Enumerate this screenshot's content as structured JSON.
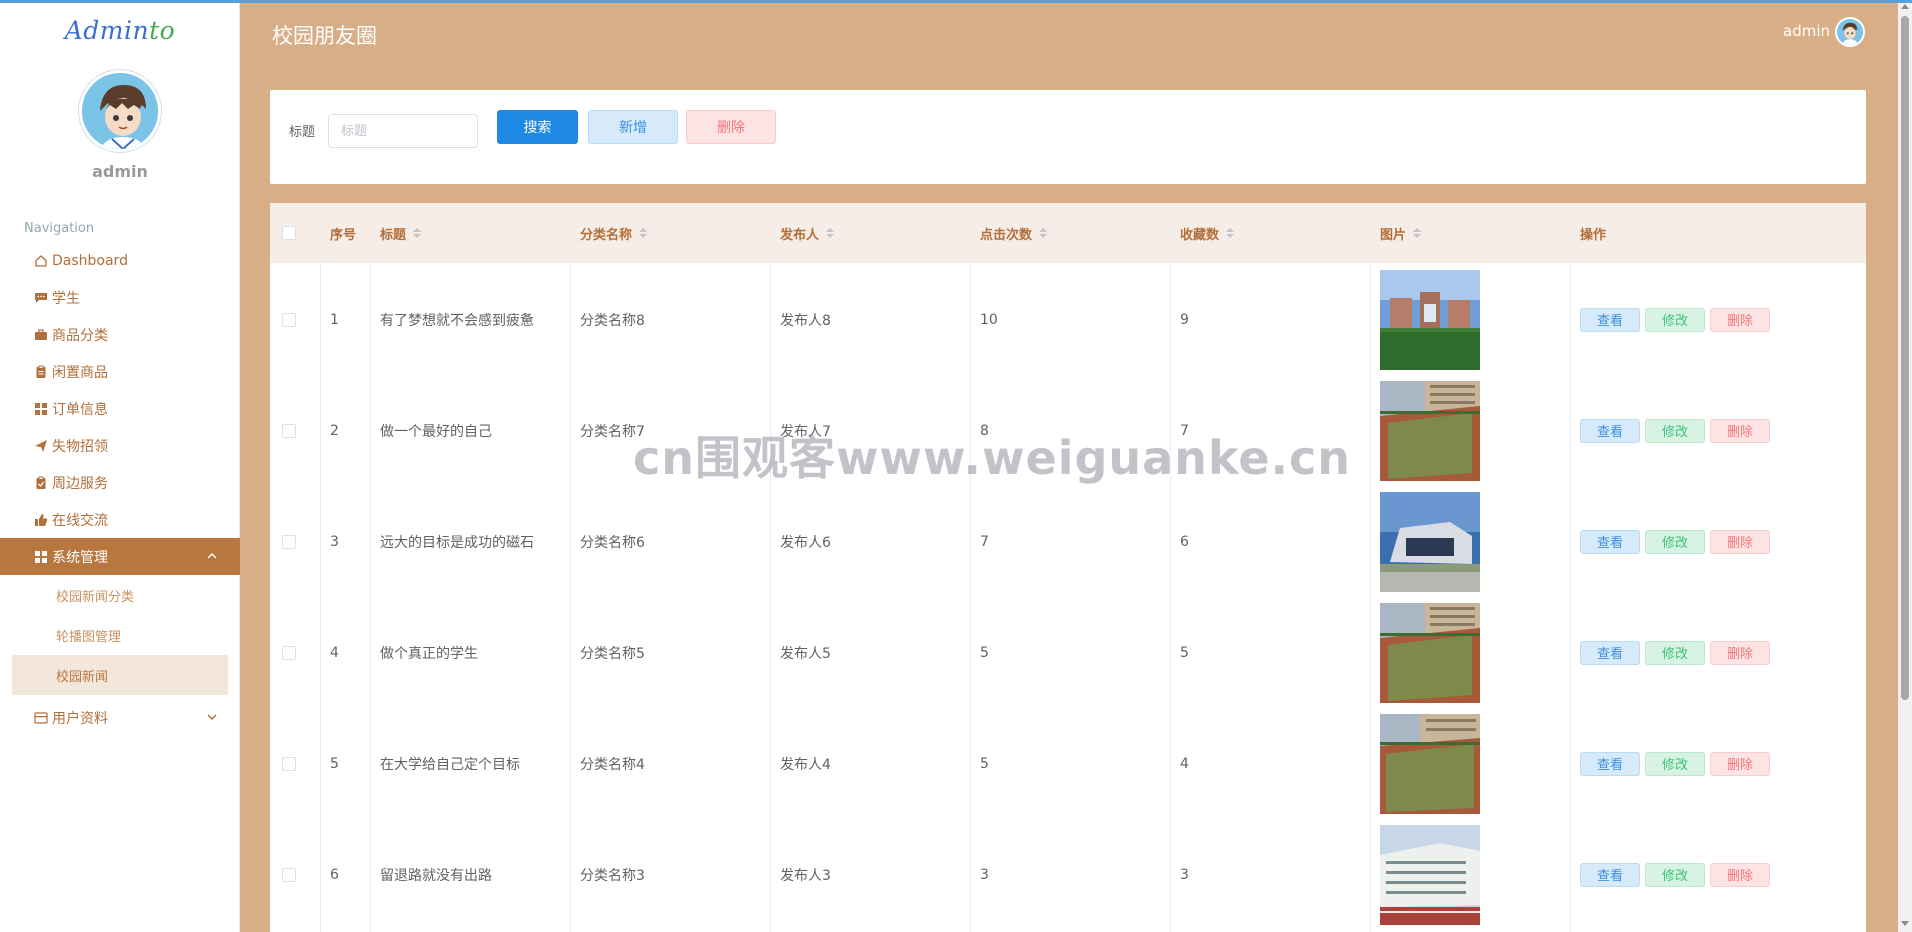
{
  "brand": {
    "part1": "Admin",
    "part2": "to"
  },
  "sidebar": {
    "username": "admin",
    "nav_title": "Navigation",
    "items": [
      {
        "label": "Dashboard",
        "icon": "home-icon"
      },
      {
        "label": "学生",
        "icon": "chat-icon"
      },
      {
        "label": "商品分类",
        "icon": "briefcase-icon"
      },
      {
        "label": "闲置商品",
        "icon": "clipboard-icon"
      },
      {
        "label": "订单信息",
        "icon": "grid-icon"
      },
      {
        "label": "失物招领",
        "icon": "send-icon"
      },
      {
        "label": "周边服务",
        "icon": "clipboard-check-icon"
      },
      {
        "label": "在线交流",
        "icon": "thumbs-up-icon"
      },
      {
        "label": "系统管理",
        "icon": "grid-icon"
      },
      {
        "label": "用户资料",
        "icon": "card-icon"
      }
    ],
    "subitems": [
      {
        "label": "校园新闻分类"
      },
      {
        "label": "轮播图管理"
      },
      {
        "label": "校园新闻"
      }
    ]
  },
  "header": {
    "title": "校园朋友圈",
    "user": "admin"
  },
  "search": {
    "label": "标题",
    "placeholder": "标题",
    "search_label": "搜索",
    "add_label": "新增",
    "delete_label": "删除"
  },
  "table": {
    "columns": [
      "序号",
      "标题",
      "分类名称",
      "发布人",
      "点击次数",
      "收藏数",
      "图片",
      "操作"
    ],
    "rows": [
      {
        "no": "1",
        "title": "有了梦想就不会感到疲惫",
        "category": "分类名称8",
        "publisher": "发布人8",
        "clicks": "10",
        "favorites": "9"
      },
      {
        "no": "2",
        "title": "做一个最好的自己",
        "category": "分类名称7",
        "publisher": "发布人7",
        "clicks": "8",
        "favorites": "7"
      },
      {
        "no": "3",
        "title": "远大的目标是成功的磁石",
        "category": "分类名称6",
        "publisher": "发布人6",
        "clicks": "7",
        "favorites": "6"
      },
      {
        "no": "4",
        "title": "做个真正的学生",
        "category": "分类名称5",
        "publisher": "发布人5",
        "clicks": "5",
        "favorites": "5"
      },
      {
        "no": "5",
        "title": "在大学给自己定个目标",
        "category": "分类名称4",
        "publisher": "发布人4",
        "clicks": "5",
        "favorites": "4"
      },
      {
        "no": "6",
        "title": "留退路就没有出路",
        "category": "分类名称3",
        "publisher": "发布人3",
        "clicks": "3",
        "favorites": "3"
      }
    ],
    "actions": {
      "view": "查看",
      "edit": "修改",
      "delete": "删除"
    }
  },
  "watermark": "cn围观客www.weiguanke.cn",
  "colors": {
    "sidebar_active": "#b8773e",
    "page_bg": "#d8ae86",
    "primary": "#1e88e5"
  }
}
